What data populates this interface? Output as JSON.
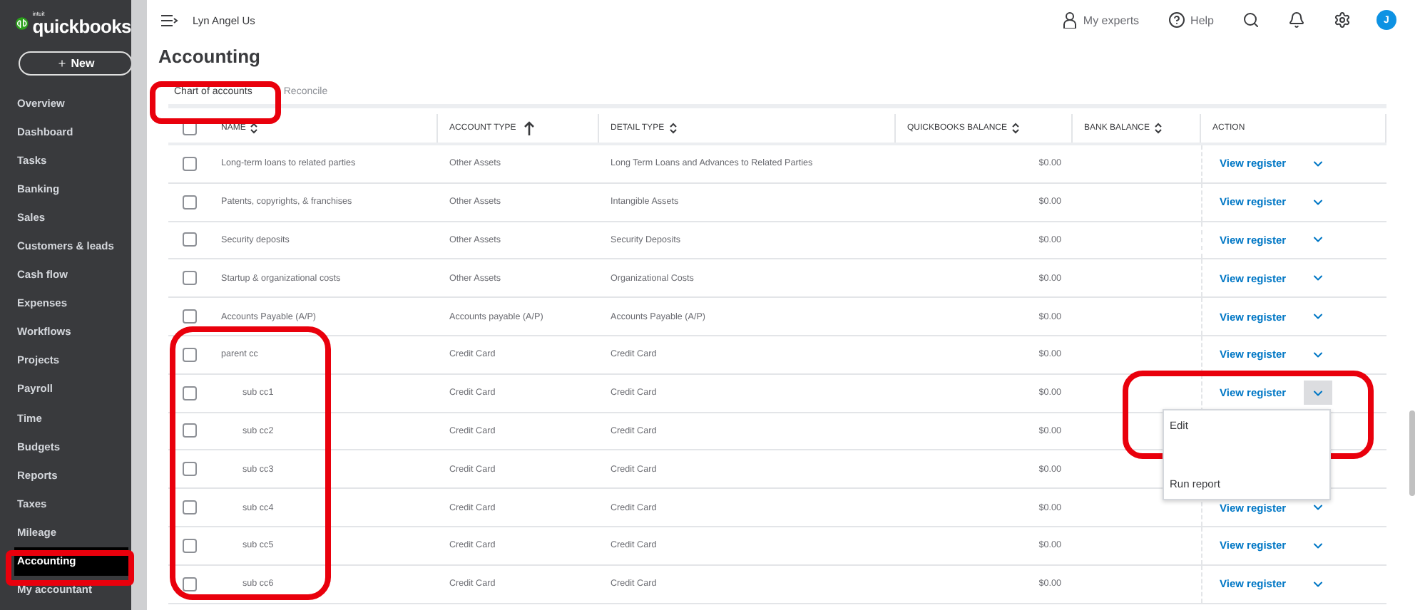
{
  "brand": {
    "tag": "intuit",
    "name": "quickbooks"
  },
  "new_button": "New",
  "sidebar": {
    "items": [
      {
        "label": "Overview",
        "selected": false
      },
      {
        "label": "Dashboard",
        "selected": false
      },
      {
        "label": "Tasks",
        "selected": false
      },
      {
        "label": "Banking",
        "selected": false
      },
      {
        "label": "Sales",
        "selected": false
      },
      {
        "label": "Customers & leads",
        "selected": false
      },
      {
        "label": "Cash flow",
        "selected": false
      },
      {
        "label": "Expenses",
        "selected": false
      },
      {
        "label": "Workflows",
        "selected": false
      },
      {
        "label": "Projects",
        "selected": false
      },
      {
        "label": "Payroll",
        "selected": false
      },
      {
        "label": "Time",
        "selected": false
      },
      {
        "label": "Budgets",
        "selected": false
      },
      {
        "label": "Reports",
        "selected": false
      },
      {
        "label": "Taxes",
        "selected": false
      },
      {
        "label": "Mileage",
        "selected": false
      },
      {
        "label": "Accounting",
        "selected": true
      },
      {
        "label": "My accountant",
        "selected": false
      }
    ]
  },
  "header": {
    "company": "Lyn Angel Us",
    "experts": "My experts",
    "help": "Help",
    "avatar": "J"
  },
  "page_title": "Accounting",
  "tabs": [
    {
      "label": "Chart of accounts",
      "selected": true
    },
    {
      "label": "Reconcile",
      "selected": false
    }
  ],
  "table": {
    "all_selected": false,
    "columns": [
      {
        "label": "NAME",
        "sortable": true,
        "sorted": false
      },
      {
        "label": "ACCOUNT TYPE",
        "sortable": true,
        "sorted": true
      },
      {
        "label": "DETAIL TYPE",
        "sortable": true,
        "sorted": false
      },
      {
        "label": "QUICKBOOKS BALANCE",
        "sortable": true,
        "sorted": false
      },
      {
        "label": "BANK BALANCE",
        "sortable": true,
        "sorted": false
      },
      {
        "label": "ACTION",
        "sortable": false,
        "sorted": false
      }
    ],
    "rows": [
      {
        "name": "Long-term loans to related parties",
        "account_type": "Other Assets",
        "detail_type": "Long Term Loans and Advances to Related Parties",
        "balance": "$0.00",
        "action": "View register",
        "checked": false,
        "menu_open": false
      },
      {
        "name": "Patents, copyrights, & franchises",
        "account_type": "Other Assets",
        "detail_type": "Intangible Assets",
        "balance": "$0.00",
        "action": "View register",
        "checked": false,
        "menu_open": false
      },
      {
        "name": "Security deposits",
        "account_type": "Other Assets",
        "detail_type": "Security Deposits",
        "balance": "$0.00",
        "action": "View register",
        "checked": false,
        "menu_open": false
      },
      {
        "name": "Startup & organizational costs",
        "account_type": "Other Assets",
        "detail_type": "Organizational Costs",
        "balance": "$0.00",
        "action": "View register",
        "checked": false,
        "menu_open": false
      },
      {
        "name": "Accounts Payable (A/P)",
        "account_type": "Accounts payable (A/P)",
        "detail_type": "Accounts Payable (A/P)",
        "balance": "$0.00",
        "action": "View register",
        "checked": false,
        "menu_open": false
      },
      {
        "name": "parent cc",
        "account_type": "Credit Card",
        "detail_type": "Credit Card",
        "balance": "$0.00",
        "action": "View register",
        "checked": false,
        "menu_open": false,
        "children": [
          {
            "name": "sub cc1",
            "account_type": "Credit Card",
            "detail_type": "Credit Card",
            "balance": "$0.00",
            "action": "View register",
            "checked": false,
            "menu_open": true
          },
          {
            "name": "sub cc2",
            "account_type": "Credit Card",
            "detail_type": "Credit Card",
            "balance": "$0.00",
            "checked": false
          },
          {
            "name": "sub cc3",
            "account_type": "Credit Card",
            "detail_type": "Credit Card",
            "balance": "$0.00",
            "checked": false
          },
          {
            "name": "sub cc4",
            "account_type": "Credit Card",
            "detail_type": "Credit Card",
            "balance": "$0.00",
            "action": "View register",
            "checked": false,
            "menu_open": false
          },
          {
            "name": "sub cc5",
            "account_type": "Credit Card",
            "detail_type": "Credit Card",
            "balance": "$0.00",
            "action": "View register",
            "checked": false,
            "menu_open": false
          },
          {
            "name": "sub cc6",
            "account_type": "Credit Card",
            "detail_type": "Credit Card",
            "balance": "$0.00",
            "action": "View register",
            "checked": false,
            "menu_open": false
          }
        ]
      }
    ]
  },
  "action_menu": {
    "items": [
      "Edit",
      "Run report"
    ]
  }
}
